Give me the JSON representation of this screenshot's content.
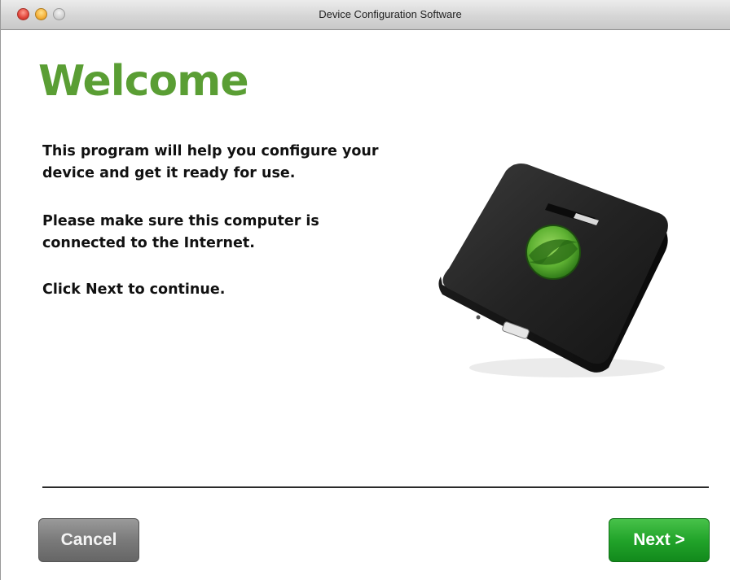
{
  "window": {
    "title": "Device Configuration Software",
    "controls": {
      "close": "close-button",
      "minimize": "minimize-button",
      "zoom": "zoom-button"
    }
  },
  "content": {
    "heading": "Welcome",
    "paragraphs": [
      "This program will help you configure your device and get it ready for use.",
      "Please make sure this computer is connected to the Internet.",
      "Click Next to continue."
    ],
    "illustration": "device-illustration"
  },
  "footer": {
    "cancel_label": "Cancel",
    "next_label": "Next >"
  },
  "colors": {
    "heading": "#5a9e34",
    "next_button": "#22a42a",
    "cancel_button": "#7a7a7a",
    "device_logo": "#6bbf3a"
  }
}
